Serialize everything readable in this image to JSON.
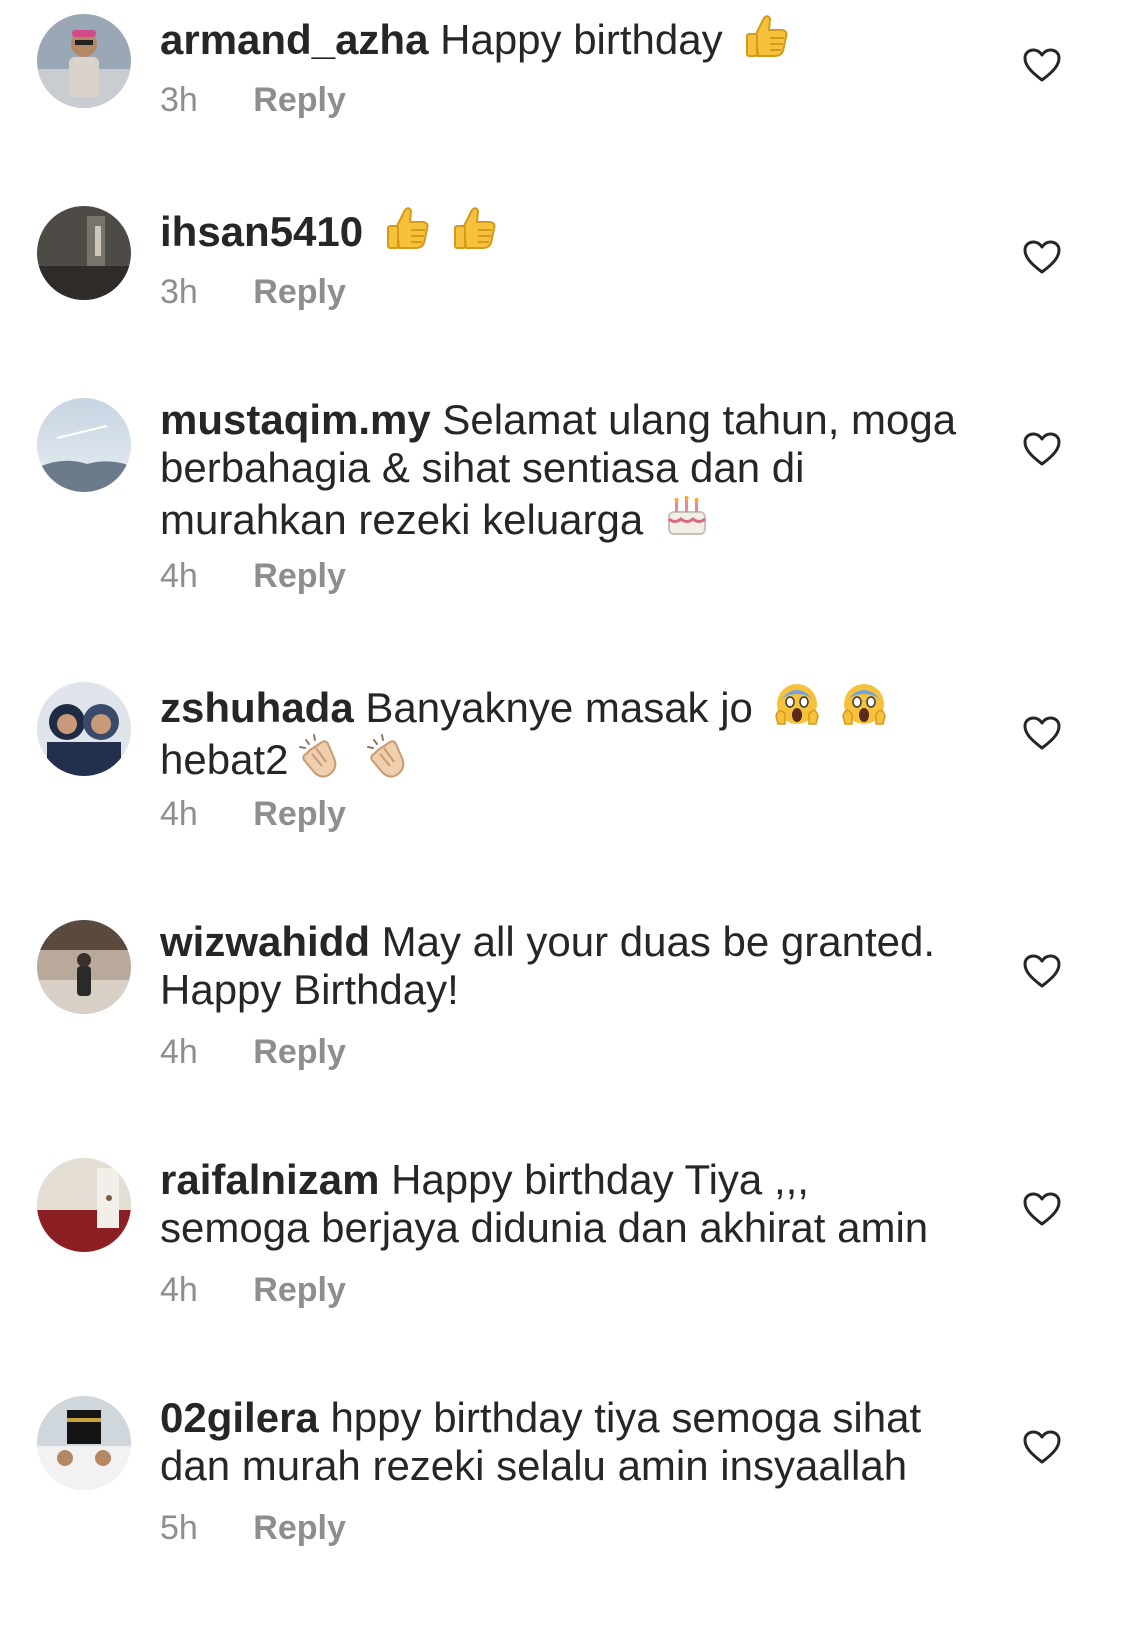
{
  "comments": [
    {
      "username": "armand_azha",
      "text": "Happy birthday",
      "emojis": [
        "thumbs-up-emoji"
      ],
      "time": "3h",
      "reply": "Reply"
    },
    {
      "username": "ihsan5410",
      "text": "",
      "emojis": [
        "thumbs-up-emoji",
        "thumbs-up-emoji"
      ],
      "time": "3h",
      "reply": "Reply"
    },
    {
      "username": "mustaqim.my",
      "text": "Selamat ulang tahun, moga berbahagia & sihat sentiasa dan di murahkan rezeki keluarga",
      "emojis": [
        "birthday-cake-emoji"
      ],
      "time": "4h",
      "reply": "Reply"
    },
    {
      "username": "zshuhada",
      "text": "Banyaknye masak jo",
      "emojis": [
        "screaming-face-emoji",
        "screaming-face-emoji"
      ],
      "text2": "hebat2",
      "emojis2": [
        "clapping-hands-emoji",
        "clapping-hands-emoji"
      ],
      "time": "4h",
      "reply": "Reply"
    },
    {
      "username": "wizwahidd",
      "text": "May all your duas be granted. Happy Birthday!",
      "time": "4h",
      "reply": "Reply"
    },
    {
      "username": "raifalnizam",
      "text": "Happy birthday Tiya ,,, semoga berjaya didunia dan akhirat amin",
      "time": "4h",
      "reply": "Reply"
    },
    {
      "username": "02gilera",
      "text": "hppy birthday tiya semoga sihat dan murah rezeki selalu amin insyaallah",
      "time": "5h",
      "reply": "Reply"
    }
  ],
  "icons": {
    "like": "heart-outline-icon"
  },
  "colors": {
    "text": "#262626",
    "meta": "#8e8e8e",
    "background": "#ffffff"
  }
}
